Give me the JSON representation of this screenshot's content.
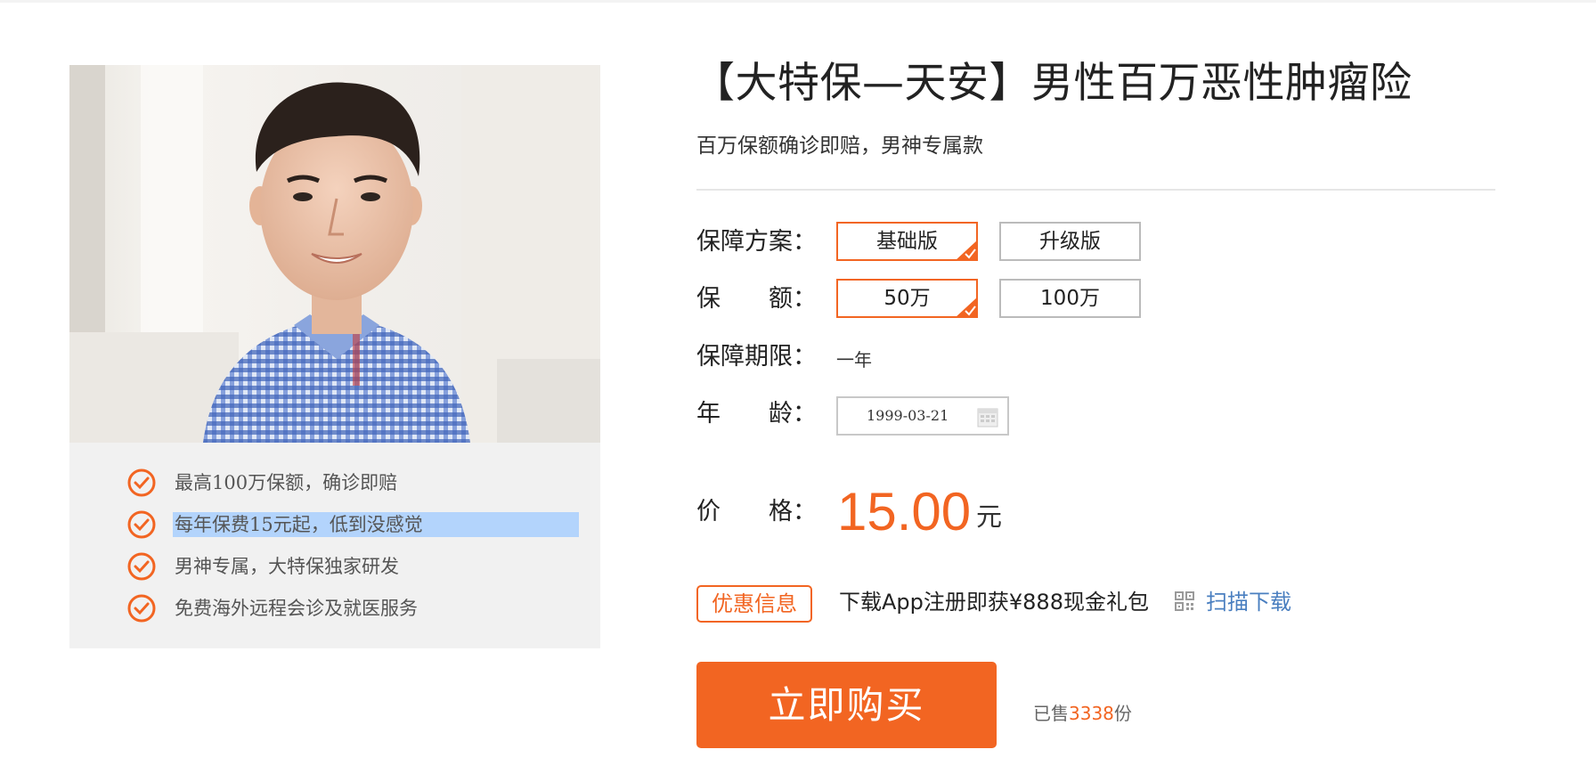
{
  "product": {
    "title": "【大特保—天安】男性百万恶性肿瘤险",
    "subtitle": "百万保额确诊即赔，男神专属款"
  },
  "features": [
    "最高100万保额，确诊即赔",
    "每年保费15元起，低到没感觉",
    "男神专属，大特保独家研发",
    "免费海外远程会诊及就医服务"
  ],
  "options": {
    "plan_label": "保障方案：",
    "plans": [
      "基础版",
      "升级版"
    ],
    "selected_plan": "基础版",
    "amount_label": "保　　额：",
    "amounts": [
      "50万",
      "100万"
    ],
    "selected_amount": "50万",
    "term_label": "保障期限：",
    "term_value": "一年",
    "age_label": "年　　龄：",
    "birth_date": "1999-03-21"
  },
  "pricing": {
    "price_label": "价　　格：",
    "price": "15.00",
    "unit": "元"
  },
  "promo": {
    "badge": "优惠信息",
    "text": "下载App注册即获¥888现金礼包",
    "scan_link": "扫描下载"
  },
  "purchase": {
    "buy_button": "立即购买",
    "sold_prefix": "已售",
    "sold_count": "3338",
    "sold_suffix": "份"
  },
  "colors": {
    "accent": "#f26522",
    "link": "#4a7fc0",
    "highlight": "#b3d4fc"
  },
  "icons": [
    "check-circle-icon",
    "corner-check-icon",
    "calendar-icon",
    "qr-code-icon"
  ]
}
